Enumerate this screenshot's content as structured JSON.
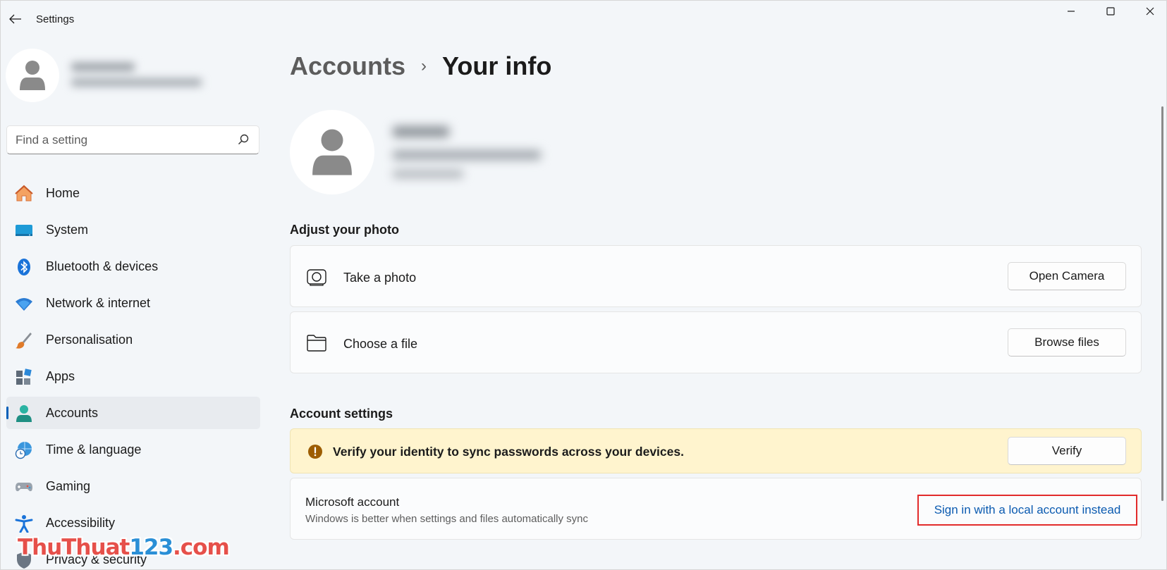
{
  "window": {
    "title": "Settings",
    "controls": {
      "minimize": "minimize",
      "maximize": "maximize",
      "close": "close"
    }
  },
  "sidebar": {
    "search": {
      "placeholder": "Find a setting",
      "value": ""
    },
    "items": [
      {
        "label": "Home",
        "icon": "home-icon",
        "active": false
      },
      {
        "label": "System",
        "icon": "system-icon",
        "active": false
      },
      {
        "label": "Bluetooth & devices",
        "icon": "bluetooth-icon",
        "active": false
      },
      {
        "label": "Network & internet",
        "icon": "wifi-icon",
        "active": false
      },
      {
        "label": "Personalisation",
        "icon": "brush-icon",
        "active": false
      },
      {
        "label": "Apps",
        "icon": "apps-icon",
        "active": false
      },
      {
        "label": "Accounts",
        "icon": "accounts-icon",
        "active": true
      },
      {
        "label": "Time & language",
        "icon": "globe-clock-icon",
        "active": false
      },
      {
        "label": "Gaming",
        "icon": "gamepad-icon",
        "active": false
      },
      {
        "label": "Accessibility",
        "icon": "accessibility-icon",
        "active": false
      },
      {
        "label": "Privacy & security",
        "icon": "shield-icon",
        "active": false
      }
    ]
  },
  "main": {
    "breadcrumb": {
      "parent": "Accounts",
      "separator": "›",
      "current": "Your info"
    },
    "photo_section": {
      "title": "Adjust your photo",
      "take_photo": {
        "label": "Take a photo",
        "button": "Open Camera"
      },
      "choose_file": {
        "label": "Choose a file",
        "button": "Browse files"
      }
    },
    "account_section": {
      "title": "Account settings",
      "warning": {
        "text": "Verify your identity to sync passwords across your devices.",
        "button": "Verify"
      },
      "microsoft_account": {
        "title": "Microsoft account",
        "subtitle": "Windows is better when settings and files automatically sync",
        "link": "Sign in with a local account instead"
      }
    }
  },
  "watermark": {
    "part1": "ThuThuat",
    "part2": "123",
    "part3": ".com"
  },
  "colors": {
    "accent": "#005fb8",
    "warning_bg": "#fff4ce",
    "warning_icon": "#9d5d00",
    "highlight_border": "#e22b2b",
    "link": "#0a5ab0"
  }
}
